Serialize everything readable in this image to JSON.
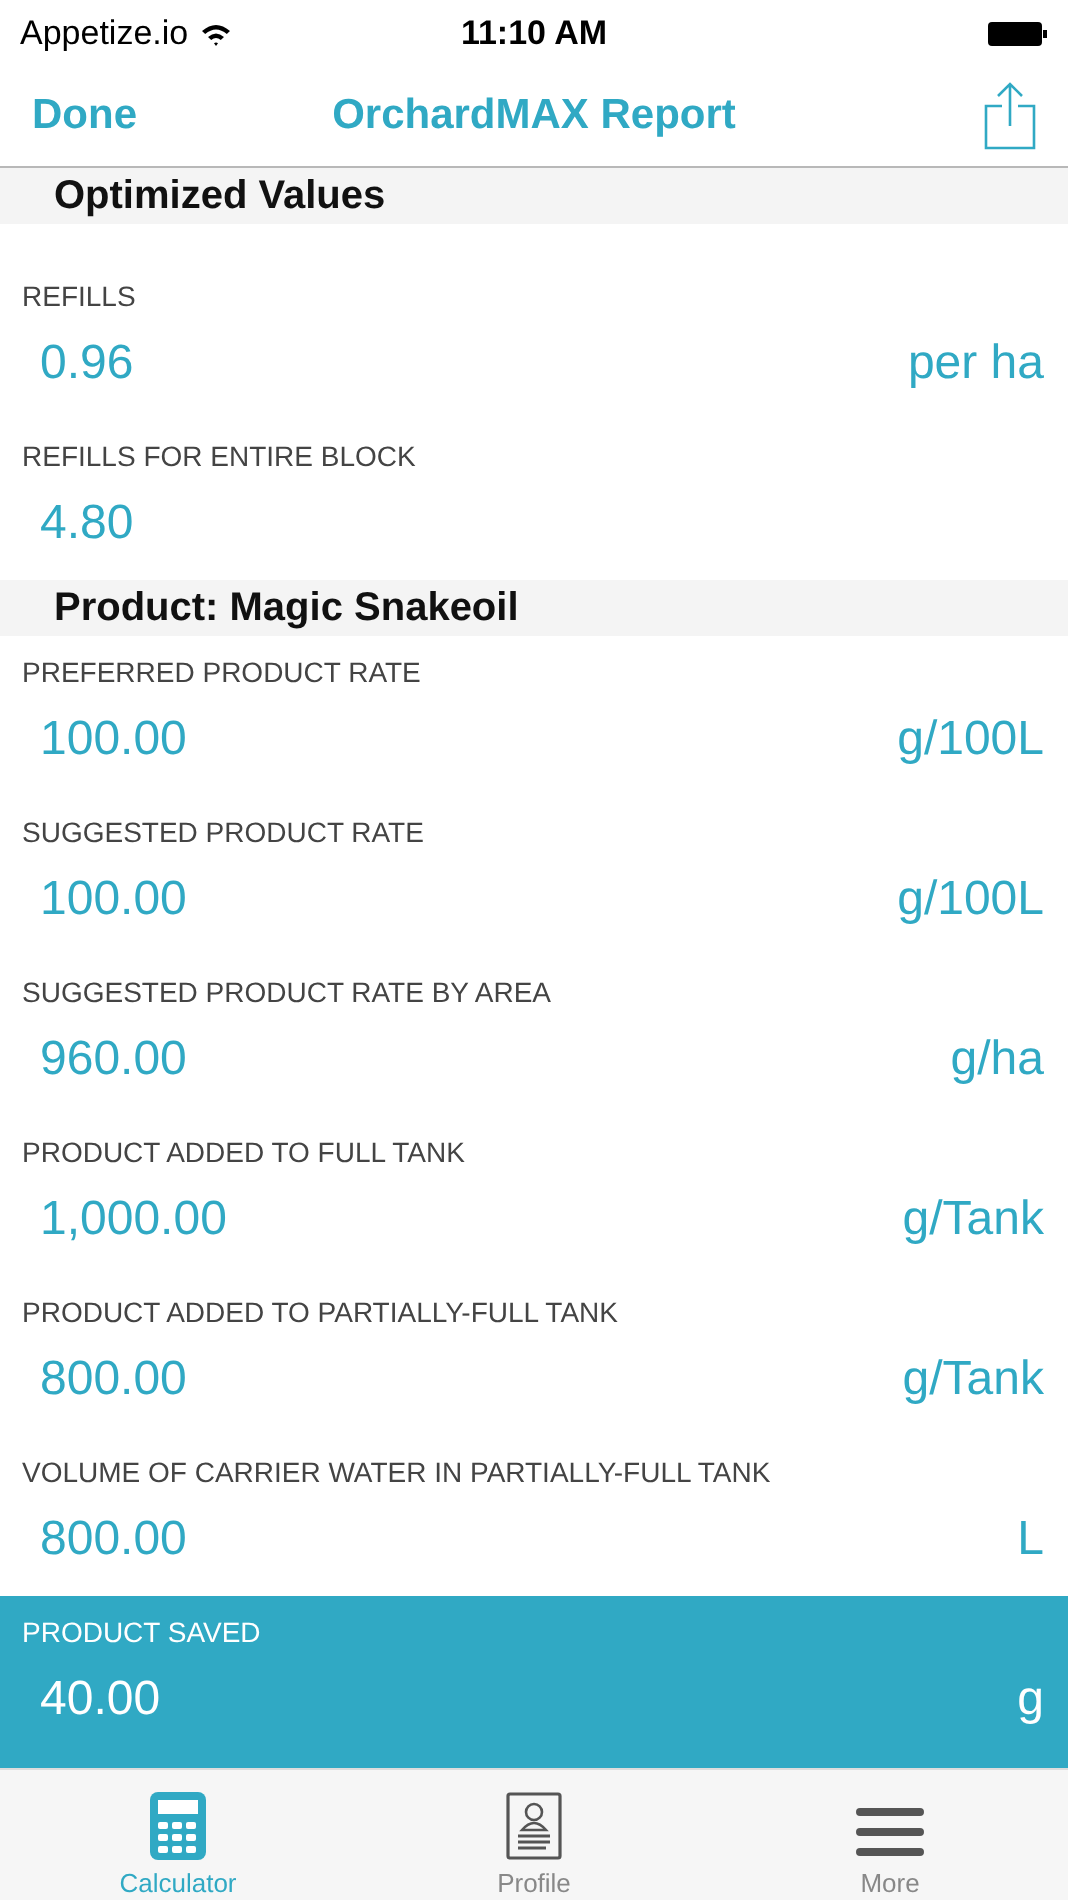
{
  "status_bar": {
    "carrier": "Appetize.io",
    "time": "11:10 AM"
  },
  "nav": {
    "left": "Done",
    "title": "OrchardMAX Report"
  },
  "sections": [
    {
      "title": "Optimized Values",
      "rows": [
        {
          "label": "REFILLS",
          "value": "0.96",
          "unit": "per ha",
          "highlighted": false
        },
        {
          "label": "REFILLS FOR ENTIRE BLOCK",
          "value": "4.80",
          "highlighted": false
        }
      ]
    },
    {
      "title": "Product: Magic Snakeoil",
      "rows": [
        {
          "label": "PREFERRED PRODUCT RATE",
          "value": "100.00",
          "unit": "g/100L",
          "highlighted": false
        },
        {
          "label": "SUGGESTED PRODUCT RATE",
          "value": "100.00",
          "unit": "g/100L",
          "highlighted": false
        },
        {
          "label": "SUGGESTED PRODUCT RATE BY AREA",
          "value": "960.00",
          "unit": "g/ha",
          "highlighted": false
        },
        {
          "label": "PRODUCT ADDED TO FULL TANK",
          "value": "1,000.00",
          "unit": "g/Tank",
          "highlighted": false
        },
        {
          "label": "PRODUCT ADDED TO PARTIALLY-FULL TANK",
          "value": "800.00",
          "unit": "g/Tank",
          "highlighted": false
        },
        {
          "label": "VOLUME OF CARRIER WATER IN PARTIALLY-FULL TANK",
          "value": "800.00",
          "unit": "L",
          "highlighted": false
        },
        {
          "label": "PRODUCT SAVED",
          "value": "40.00",
          "unit": "g",
          "highlighted": true
        }
      ]
    }
  ],
  "tabs": [
    {
      "label": "Calculator",
      "kind": "calculator",
      "selected": true
    },
    {
      "label": "Profile",
      "kind": "profile",
      "selected": false
    },
    {
      "label": "More",
      "kind": "more",
      "selected": false
    }
  ]
}
